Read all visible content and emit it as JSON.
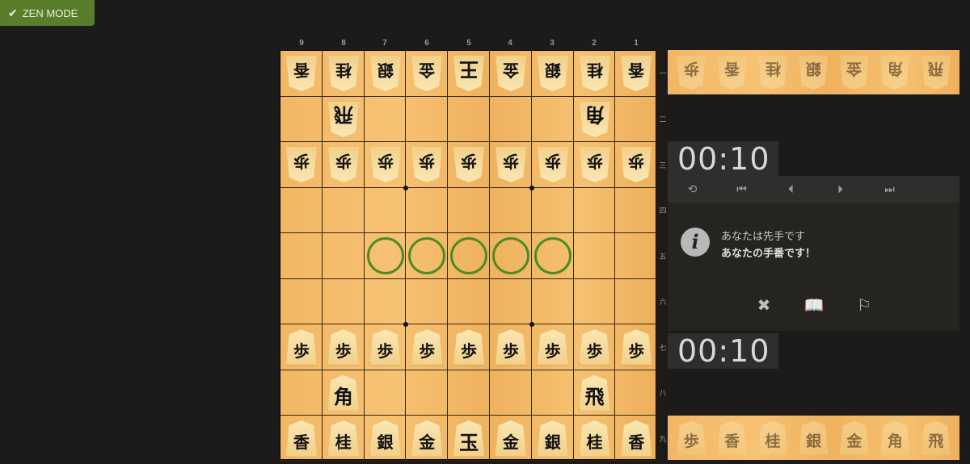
{
  "zen_mode": {
    "label": "ZEN MODE"
  },
  "board": {
    "files": [
      "9",
      "8",
      "7",
      "6",
      "5",
      "4",
      "3",
      "2",
      "1"
    ],
    "ranks": [
      "一",
      "二",
      "三",
      "四",
      "五",
      "六",
      "七",
      "八",
      "九"
    ],
    "gote_back": [
      "香",
      "桂",
      "銀",
      "金",
      "王",
      "金",
      "銀",
      "桂",
      "香"
    ],
    "gote_rook": "飛",
    "gote_bishop": "角",
    "pawn": "歩",
    "sente_bishop": "角",
    "sente_rook": "飛",
    "sente_back": [
      "香",
      "桂",
      "銀",
      "金",
      "玉",
      "金",
      "銀",
      "桂",
      "香"
    ]
  },
  "hands": {
    "top": [
      "歩",
      "香",
      "桂",
      "銀",
      "金",
      "角",
      "飛"
    ],
    "bottom": [
      "歩",
      "香",
      "桂",
      "銀",
      "金",
      "角",
      "飛"
    ]
  },
  "clocks": {
    "opponent": "00:10",
    "player": "00:10"
  },
  "controls": {
    "flip": "⟲",
    "first": "⏮",
    "prev": "⏴",
    "next": "⏵",
    "last": "⏭"
  },
  "status": {
    "line1": "あなたは先手です",
    "line2": "あなたの手番です！"
  },
  "actions": {
    "abort": "✖",
    "takeback": "📖",
    "resign": "⚐"
  },
  "colors": {
    "board": "#f6c273",
    "hint": "#4e8a24",
    "accent": "#5a7d2c"
  }
}
